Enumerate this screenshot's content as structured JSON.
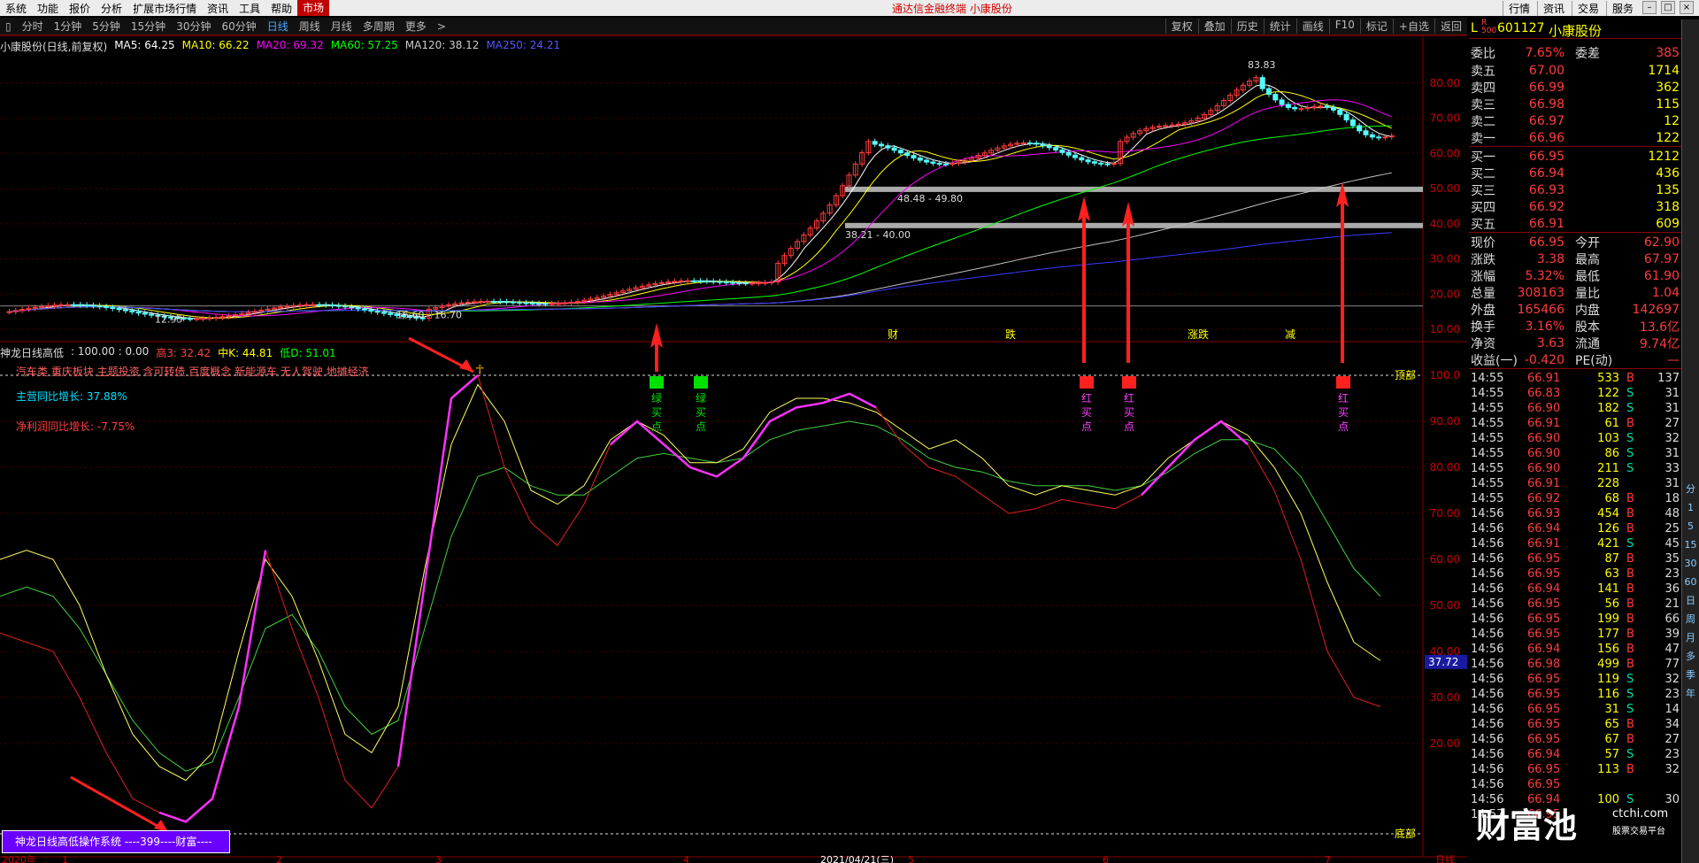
{
  "menu": [
    "系统",
    "功能",
    "报价",
    "分析",
    "扩展市场行情",
    "资讯",
    "工具",
    "帮助"
  ],
  "market_tab": "市场",
  "app_title": "通达信金融终端 小康股份",
  "right_menu": [
    "行情",
    "资讯",
    "交易",
    "服务"
  ],
  "periods": [
    "分时",
    "1分钟",
    "5分钟",
    "15分钟",
    "30分钟",
    "60分钟",
    "日线",
    "周线",
    "月线",
    "多周期",
    "更多"
  ],
  "selected_period": "日线",
  "toolbar_right": [
    "复权",
    "叠加",
    "历史",
    "统计",
    "画线",
    "F10",
    "标记",
    "+自选",
    "返回"
  ],
  "stock_info": {
    "name": "小康股份(日线,前复权)",
    "ma5": "MA5: 64.25",
    "ma10": "MA10: 66.22",
    "ma20": "MA20: 69.32",
    "ma60": "MA60: 57.25",
    "ma120": "MA120: 38.12",
    "ma250": "MA250: 24.21"
  },
  "price_axis": [
    "80.00",
    "70.00",
    "60.00",
    "50.00",
    "40.00",
    "30.00",
    "20.00",
    "10.00"
  ],
  "annotations": {
    "high": "83.83",
    "range1": "48.48 - 49.80",
    "range2": "38.21 - 40.00",
    "range3": "16.60 - 16.70",
    "low": "12.95"
  },
  "event_marks": [
    "财",
    "跌",
    "涨跌",
    "减"
  ],
  "indicator": {
    "name": "神龙日线高低",
    "params": ": 100.00 : 0.00",
    "high3": "高3: 32.42",
    "midk": "中K: 44.81",
    "low": "低D: 51.01"
  },
  "concepts": "汽车类 重庆板块 主题投资 含可转债 百度概念 新能源车 无人驾驶 地摊经济",
  "main_growth": "主营同比增长: 37.88%",
  "profit_growth": "净利润同比增长: -7.75%",
  "top_label": "顶部",
  "bottom_label": "底部",
  "ind_axis": [
    "100.0",
    "90.00",
    "80.00",
    "70.00",
    "60.00",
    "50.00",
    "40.00",
    "30.00",
    "20.00"
  ],
  "ind_current": "37.72",
  "green_label": "绿买点",
  "red_label": "红买点",
  "bubble": "神龙日线高低操作系统 ----399----财富----",
  "date_axis": [
    "2020年",
    "1",
    "2",
    "3",
    "4",
    "2021/04/21(三)",
    "5",
    "6",
    "7",
    "日线"
  ],
  "quote": {
    "flag": "L",
    "flag_sub": "R 500",
    "code": "601127",
    "name": "小康股份",
    "weibi_l": "委比",
    "weibi": "7.65%",
    "weicha_l": "委差",
    "weicha": "385",
    "sell": [
      {
        "l": "卖五",
        "p": "67.00",
        "v": "1714"
      },
      {
        "l": "卖四",
        "p": "66.99",
        "v": "362"
      },
      {
        "l": "卖三",
        "p": "66.98",
        "v": "115"
      },
      {
        "l": "卖二",
        "p": "66.97",
        "v": "12"
      },
      {
        "l": "卖一",
        "p": "66.96",
        "v": "122"
      }
    ],
    "buy": [
      {
        "l": "买一",
        "p": "66.95",
        "v": "1212"
      },
      {
        "l": "买二",
        "p": "66.94",
        "v": "436"
      },
      {
        "l": "买三",
        "p": "66.93",
        "v": "135"
      },
      {
        "l": "买四",
        "p": "66.92",
        "v": "318"
      },
      {
        "l": "买五",
        "p": "66.91",
        "v": "609"
      }
    ],
    "stats": [
      {
        "l1": "现价",
        "v1": "66.95",
        "l2": "今开",
        "v2": "62.90"
      },
      {
        "l1": "涨跌",
        "v1": "3.38",
        "l2": "最高",
        "v2": "67.97"
      },
      {
        "l1": "涨幅",
        "v1": "5.32%",
        "l2": "最低",
        "v2": "61.90"
      },
      {
        "l1": "总量",
        "v1": "308163",
        "l2": "量比",
        "v2": "1.04"
      },
      {
        "l1": "外盘",
        "v1": "165466",
        "l2": "内盘",
        "v2": "142697"
      },
      {
        "l1": "换手",
        "v1": "3.16%",
        "l2": "股本",
        "v2": "13.6亿"
      },
      {
        "l1": "净资",
        "v1": "3.63",
        "l2": "流通",
        "v2": "9.74亿"
      },
      {
        "l1": "收益(一)",
        "v1": "-0.420",
        "l2": "PE(动)",
        "v2": "—"
      }
    ],
    "ticks": [
      [
        "14:55",
        "66.91",
        "533",
        "B",
        "137"
      ],
      [
        "14:55",
        "66.83",
        "122",
        "S",
        "31"
      ],
      [
        "14:55",
        "66.90",
        "182",
        "S",
        "31"
      ],
      [
        "14:55",
        "66.91",
        "61",
        "B",
        "27"
      ],
      [
        "14:55",
        "66.90",
        "103",
        "S",
        "32"
      ],
      [
        "14:55",
        "66.90",
        "86",
        "S",
        "31"
      ],
      [
        "14:55",
        "66.90",
        "211",
        "S",
        "33"
      ],
      [
        "14:55",
        "66.91",
        "228",
        "",
        "31"
      ],
      [
        "14:55",
        "66.92",
        "68",
        "B",
        "18"
      ],
      [
        "14:56",
        "66.93",
        "454",
        "B",
        "48"
      ],
      [
        "14:56",
        "66.94",
        "126",
        "B",
        "25"
      ],
      [
        "14:56",
        "66.91",
        "421",
        "S",
        "45"
      ],
      [
        "14:56",
        "66.95",
        "87",
        "B",
        "35"
      ],
      [
        "14:56",
        "66.95",
        "63",
        "B",
        "23"
      ],
      [
        "14:56",
        "66.94",
        "141",
        "B",
        "36"
      ],
      [
        "14:56",
        "66.95",
        "56",
        "B",
        "21"
      ],
      [
        "14:56",
        "66.95",
        "199",
        "B",
        "66"
      ],
      [
        "14:56",
        "66.95",
        "177",
        "B",
        "39"
      ],
      [
        "14:56",
        "66.94",
        "156",
        "B",
        "47"
      ],
      [
        "14:56",
        "66.98",
        "499",
        "B",
        "77"
      ],
      [
        "14:56",
        "66.95",
        "119",
        "S",
        "32"
      ],
      [
        "14:56",
        "66.95",
        "116",
        "S",
        "23"
      ],
      [
        "14:56",
        "66.95",
        "31",
        "S",
        "14"
      ],
      [
        "14:56",
        "66.95",
        "65",
        "B",
        "34"
      ],
      [
        "14:56",
        "66.95",
        "67",
        "B",
        "27"
      ],
      [
        "14:56",
        "66.94",
        "57",
        "S",
        "23"
      ],
      [
        "14:56",
        "66.95",
        "113",
        "B",
        "32"
      ],
      [
        "14:56",
        "66.95",
        "",
        "",
        ""
      ],
      [
        "14:56",
        "66.94",
        "100",
        "S",
        "30"
      ],
      [
        "14:57",
        "66.95",
        "",
        "",
        ""
      ]
    ]
  },
  "side_tabs": [
    "分",
    "1",
    "5",
    "15",
    "30",
    "60",
    "日",
    "周",
    "月",
    "多",
    "季",
    "年"
  ],
  "watermark": "财富池",
  "watermark_site": "ctchi.com",
  "watermark_sub": "股票交易平台",
  "colors": {
    "up": "#ff3c3c",
    "down": "#54ffff",
    "ma5": "#ffffff",
    "ma10": "#ffff00",
    "ma20": "#ff00ff",
    "ma60": "#00ff00",
    "ma120": "#c0c0c0",
    "ma250": "#3a3aff"
  }
}
